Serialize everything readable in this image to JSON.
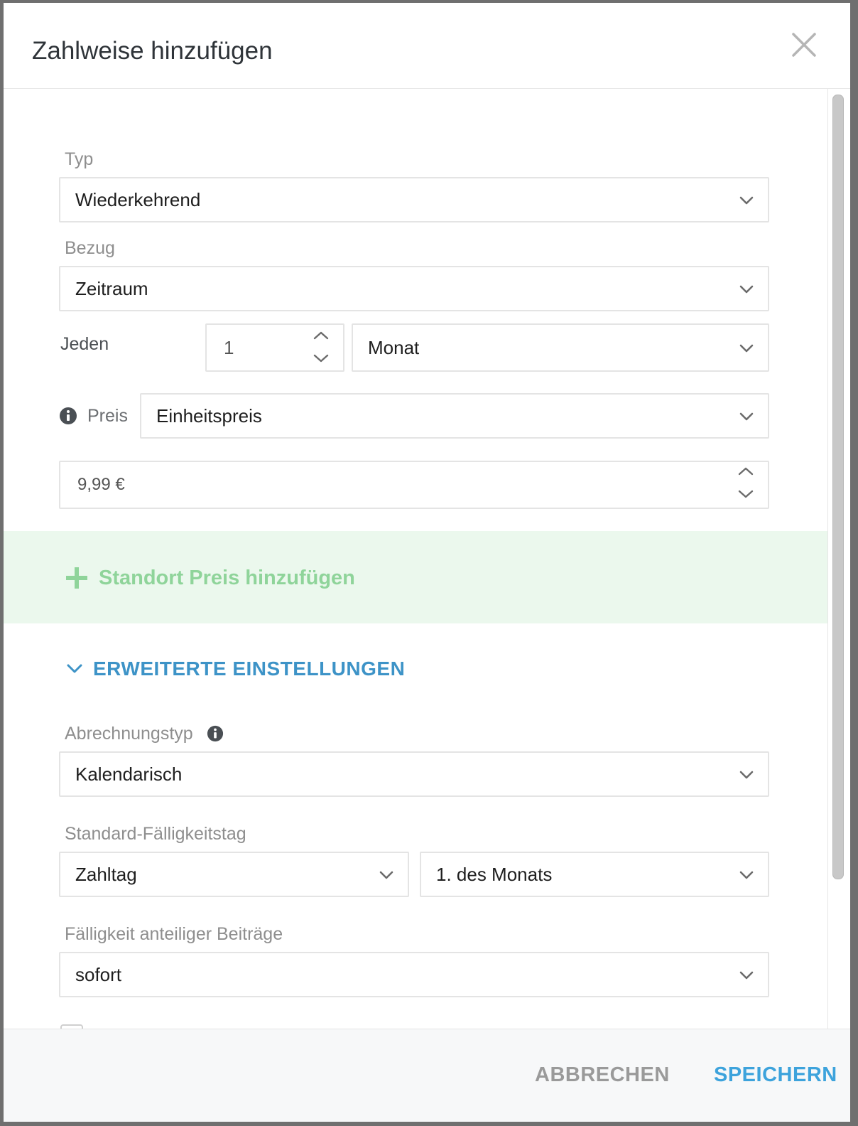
{
  "dialog": {
    "title": "Zahlweise hinzufügen",
    "close_icon": "close-icon"
  },
  "form": {
    "typ": {
      "label": "Typ",
      "value": "Wiederkehrend"
    },
    "bezug": {
      "label": "Bezug",
      "value": "Zeitraum"
    },
    "jeden": {
      "label": "Jeden",
      "count": "1",
      "unit": "Monat"
    },
    "preis": {
      "label": "Preis",
      "info_icon": "info-icon",
      "value": "Einheitspreis",
      "amount": "9,99 €"
    },
    "add_location_price": {
      "icon": "plus-icon",
      "label": "Standort Preis hinzufügen"
    },
    "advanced": {
      "toggle_label": "ERWEITERTE EINSTELLUNGEN",
      "abrechnungstyp": {
        "label": "Abrechnungstyp",
        "value": "Kalendarisch"
      },
      "faelligkeitstag": {
        "label": "Standard-Fälligkeitstag",
        "type_value": "Zahltag",
        "day_value": "1. des Monats"
      },
      "anteilig": {
        "label": "Fälligkeit anteiliger Beiträge",
        "value": "sofort"
      }
    }
  },
  "footer": {
    "cancel_label": "ABBRECHEN",
    "save_label": "SPEICHERN"
  },
  "colors": {
    "accent_blue": "#3da3dc",
    "advanced_blue": "#3d93c7",
    "green_band": "#ebf8ed",
    "green_text": "#8fd49a"
  }
}
